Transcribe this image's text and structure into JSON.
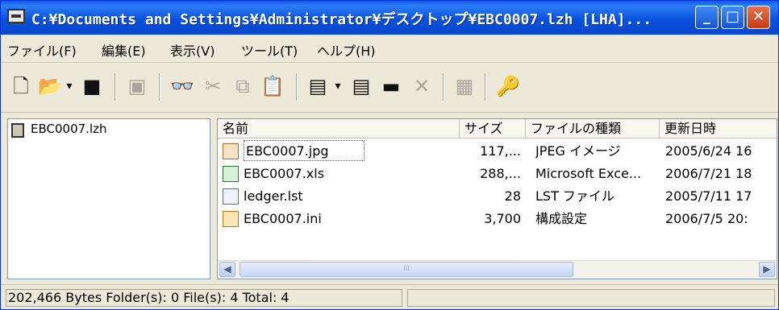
{
  "window": {
    "title": "C:¥Documents and Settings¥Administrator¥デスクトップ¥EBC0007.lzh [LHA]...",
    "controls": {
      "minimize": "_",
      "maximize": "□",
      "close": "✕"
    }
  },
  "menu": [
    "ファイル(F)",
    "編集(E)",
    "表示(V)",
    "ツール(T)",
    "ヘルプ(H)"
  ],
  "toolbar": {
    "icons": [
      "new-icon",
      "open-folder-icon",
      "dropdown-icon",
      "save-icon",
      "extract-icon",
      "find-icon",
      "cut-icon",
      "copy-icon",
      "paste-icon",
      "add-files-icon",
      "dropdown-icon",
      "add-icon",
      "view-icon",
      "delete-icon",
      "properties-icon",
      "tools-icon"
    ]
  },
  "tree": {
    "item": "EBC0007.lzh"
  },
  "list": {
    "columns": [
      "名前",
      "サイズ",
      "ファイルの種類",
      "更新日時"
    ],
    "rows": [
      {
        "name": "EBC0007.jpg",
        "size": "117,...",
        "type": "JPEG イメージ",
        "date": "2005/6/24 16",
        "icon": "jpg-file-icon"
      },
      {
        "name": "EBC0007.xls",
        "size": "288,...",
        "type": "Microsoft Exce...",
        "date": "2006/7/21 18",
        "icon": "excel-file-icon"
      },
      {
        "name": "ledger.lst",
        "size": "28",
        "type": "LST ファイル",
        "date": "2005/7/11 17",
        "icon": "lst-file-icon"
      },
      {
        "name": "EBC0007.ini",
        "size": "3,700",
        "type": "構成設定",
        "date": "2006/7/5 20:",
        "icon": "ini-file-icon"
      }
    ],
    "scroll_track": "III"
  },
  "status": {
    "text": "202,466 Bytes  Folder(s): 0  File(s): 4  Total: 4"
  }
}
